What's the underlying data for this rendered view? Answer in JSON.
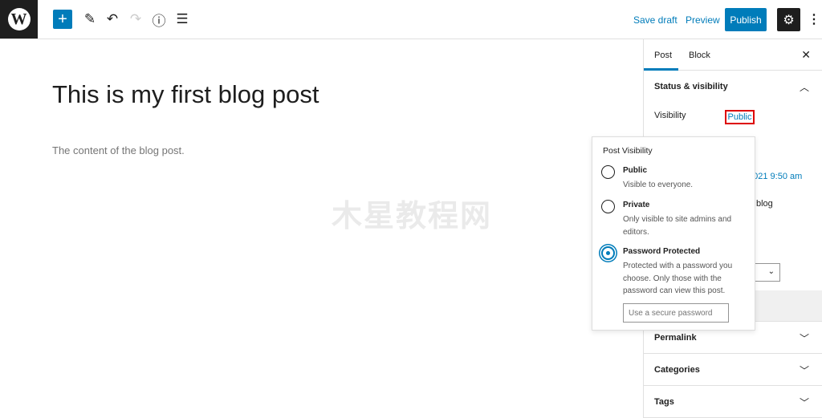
{
  "header": {
    "logo": "W",
    "add_icon": "plus-icon",
    "save_draft": "Save draft",
    "preview": "Preview",
    "publish": "Publish",
    "settings_icon": "gear-icon",
    "more_icon": "⋮"
  },
  "editor": {
    "title": "This is my first blog post",
    "content": "The content of the blog post."
  },
  "watermark": "木星教程网",
  "sidebar": {
    "tabs": [
      "Post",
      "Block"
    ],
    "status_panel": {
      "title": "Status & visibility",
      "visibility_label": "Visibility",
      "visibility_value": "Public",
      "date_fragment": "2021 9:50 am",
      "sticky_fragment": "blog"
    },
    "panels": [
      "Permalink",
      "Categories",
      "Tags"
    ]
  },
  "popover": {
    "title": "Post Visibility",
    "options": [
      {
        "label": "Public",
        "desc": "Visible to everyone.",
        "selected": false
      },
      {
        "label": "Private",
        "desc": "Only visible to site admins and editors.",
        "selected": false
      },
      {
        "label": "Password Protected",
        "desc": "Protected with a password you choose. Only those with the password can view this post.",
        "selected": true
      }
    ],
    "password_placeholder": "Use a secure password"
  },
  "colors": {
    "accent": "#007cba",
    "dark": "#1e1e1e",
    "highlight": "#dd0000"
  }
}
